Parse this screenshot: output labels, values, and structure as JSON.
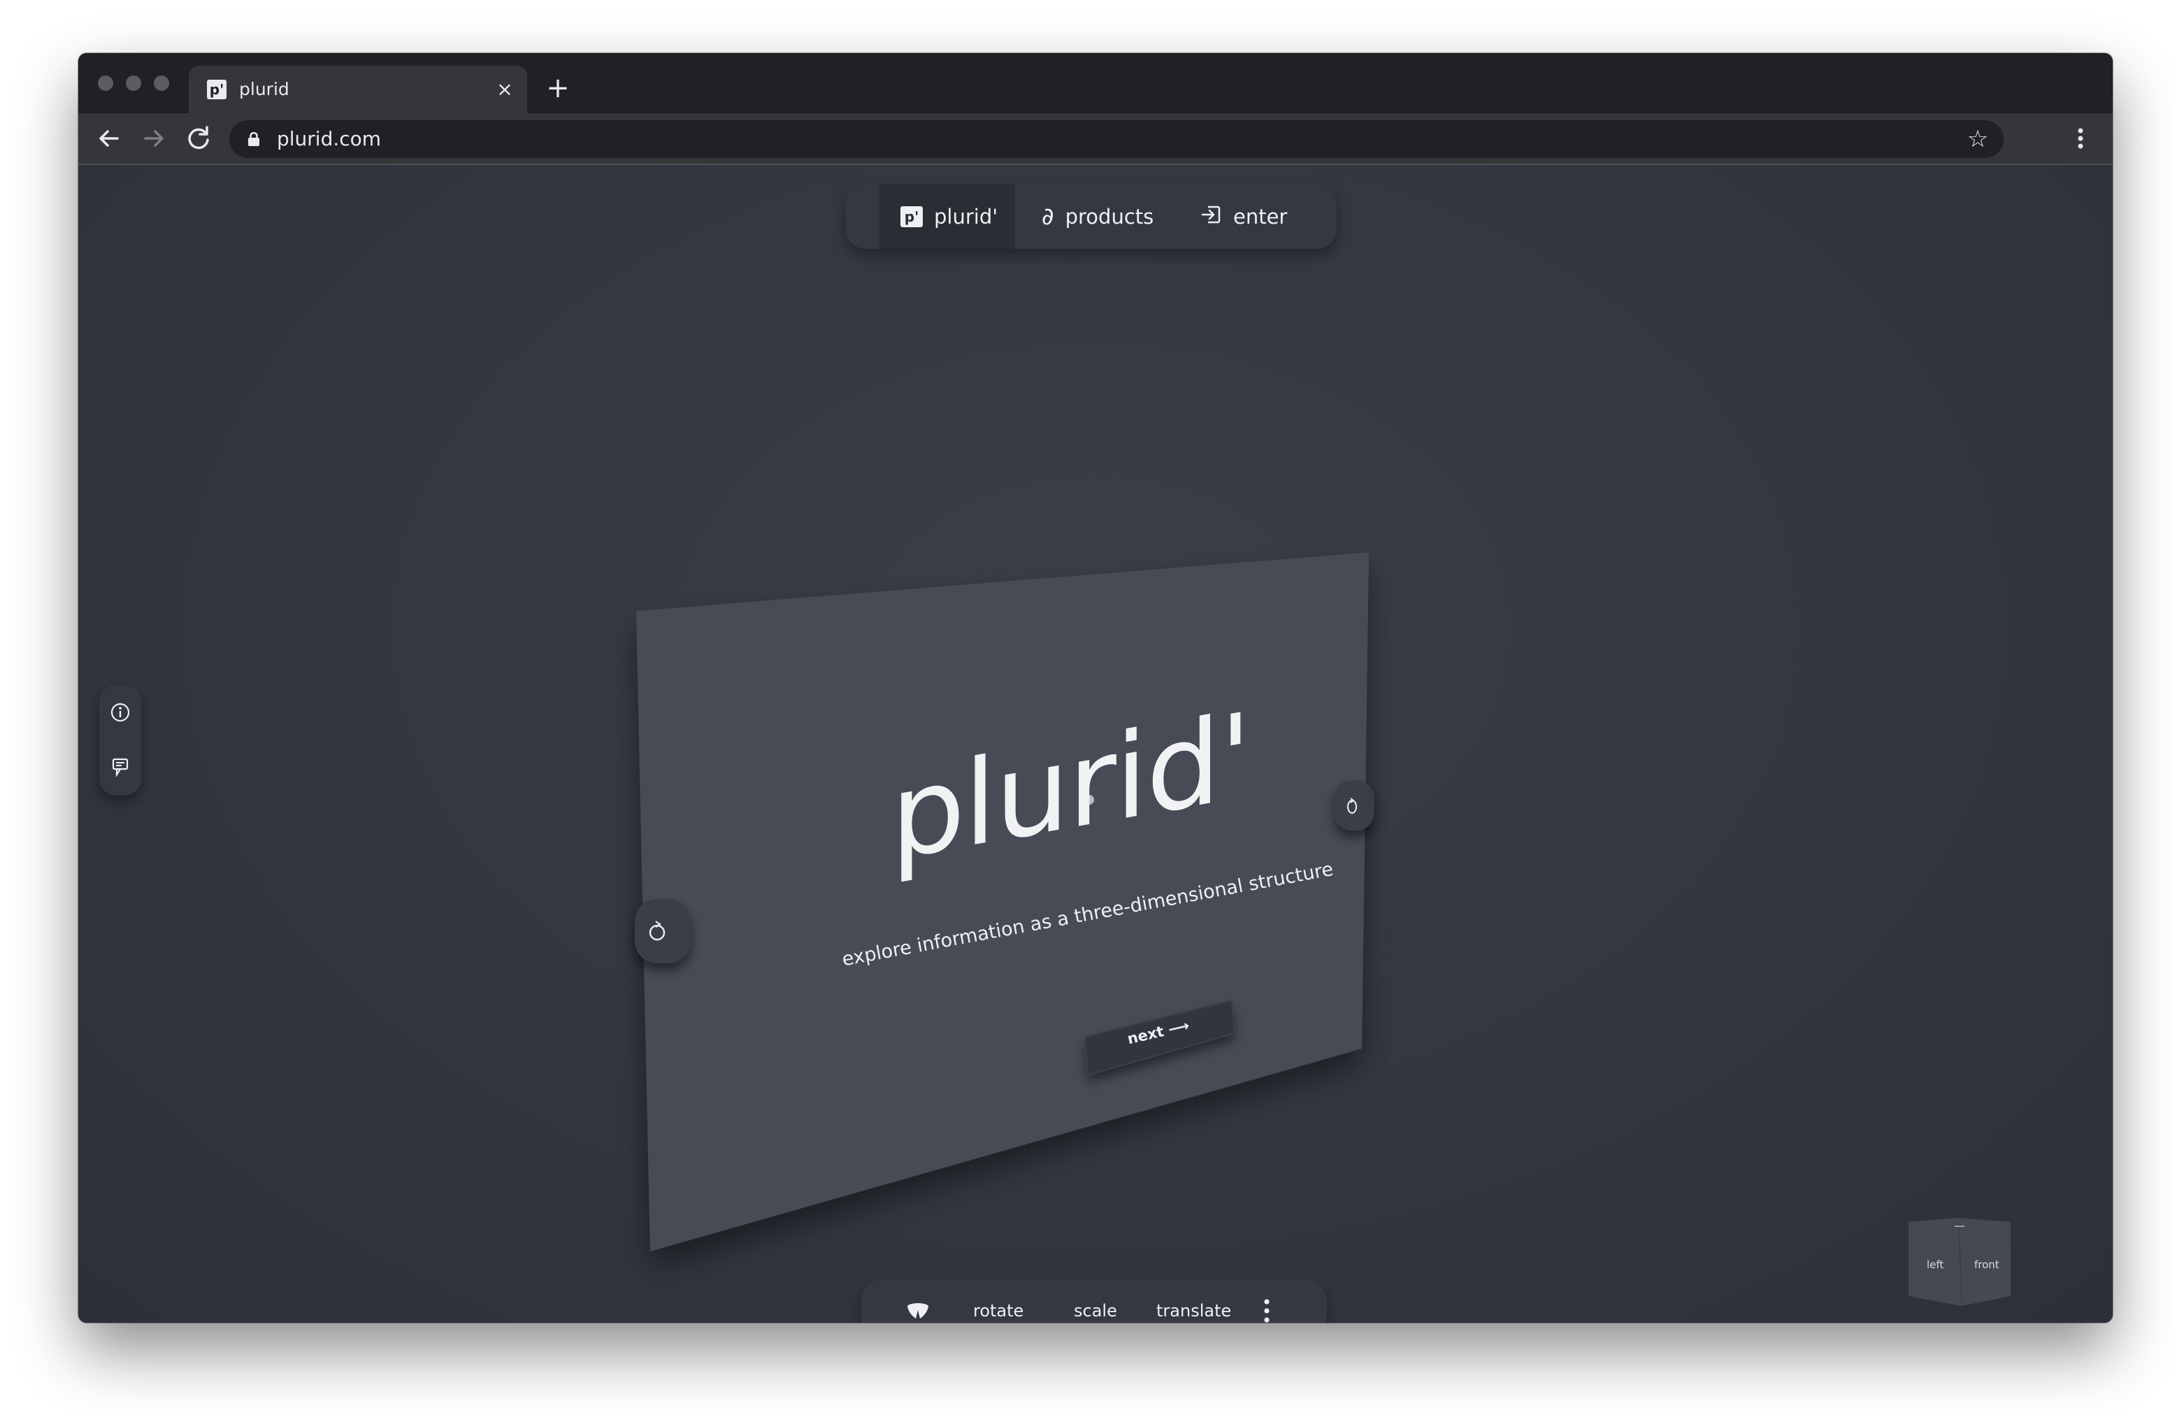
{
  "browser": {
    "tab": {
      "favicon_text": "p'",
      "title": "plurid"
    },
    "new_tab_icon": "plus-icon",
    "address": {
      "url": "plurid.com"
    }
  },
  "topnav": {
    "items": [
      {
        "label": "plurid'",
        "icon": "plurid-logo-icon",
        "active": true
      },
      {
        "label": "products",
        "icon": "partial-derivative-icon"
      },
      {
        "label": "enter",
        "icon": "enter-icon"
      }
    ]
  },
  "plane": {
    "title": "plurid'",
    "subtitle": "explore information as a three-dimensional structure",
    "next_label": "next ⟶"
  },
  "bottombar": {
    "items": [
      {
        "label": "rotate"
      },
      {
        "label": "scale"
      },
      {
        "label": "translate"
      }
    ]
  },
  "cube": {
    "left_label": "left",
    "front_label": "front"
  },
  "colors": {
    "background": "#2d313a",
    "plane": "#474c57",
    "text": "#eef0f3",
    "chrome_dark": "#202124",
    "chrome_mid": "#35363a"
  }
}
